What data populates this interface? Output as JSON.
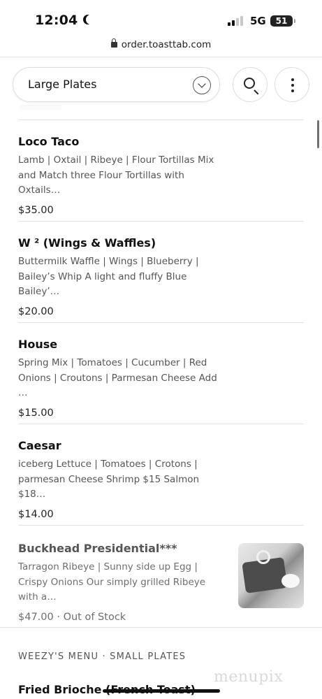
{
  "status_bar": {
    "time": "12:04",
    "network": "5G",
    "battery": "51"
  },
  "browser": {
    "url": "order.toasttab.com"
  },
  "toolbar": {
    "category": "Large Plates"
  },
  "items": [
    {
      "name": "Loco Taco",
      "description": "Lamb | Oxtail | Ribeye | Flour Tortillas  Mix and Match three Flour Tortillas with Oxtails…",
      "price": "$35.00"
    },
    {
      "name": "W ² (Wings & Waffles)",
      "description": "Buttermilk Waffle | Wings | Blueberry | Bailey’s Whip  A light and fluffy Blue Bailey’…",
      "price": "$20.00"
    },
    {
      "name": "House",
      "description": "Spring Mix | Tomatoes | Cucumber | Red Onions | Croutons | Parmesan Cheese Add …",
      "price": "$15.00"
    },
    {
      "name": "Caesar",
      "description": "iceberg Lettuce | Tomatoes | Crotons | parmesan Cheese  Shrimp $15 Salmon $18…",
      "price": "$14.00"
    },
    {
      "name": "Buckhead Presidential***",
      "description": "Tarragon Ribeye | Sunny side up Egg | Crispy Onions  Our simply grilled Ribeye with a…",
      "price": "$47.00",
      "availability": "· Out of Stock"
    }
  ],
  "next_section": {
    "header": "WEEZY'S MENU · SMALL PLATES",
    "first_item": "Fried Brioche (French Toast)"
  },
  "watermark": "menupix",
  "icons": {
    "lock": "lock-icon",
    "chevron": "chevron-down-icon",
    "search": "search-icon",
    "more": "more-vertical-icon"
  }
}
